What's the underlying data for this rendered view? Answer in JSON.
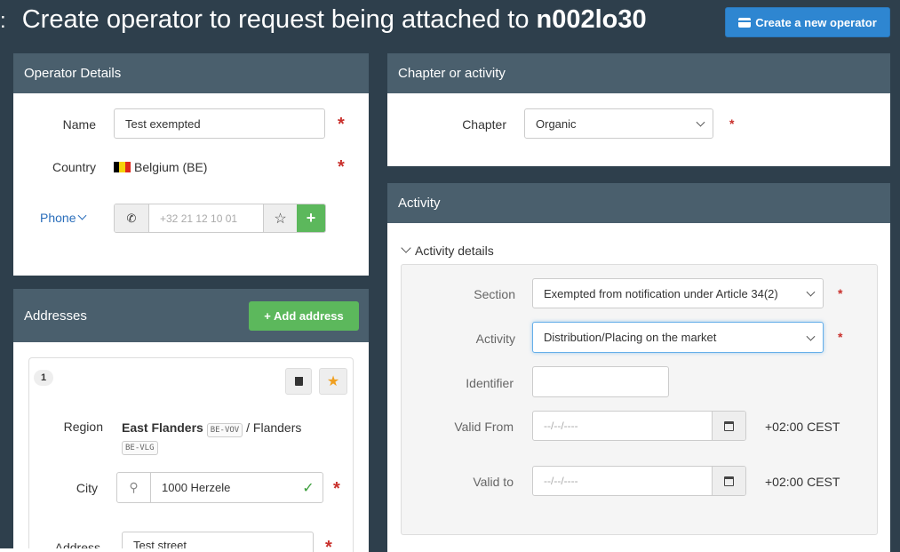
{
  "header": {
    "title_prefix": "Create operator to request being attached to ",
    "title_code": "n002lo30",
    "create_button": "Create a new operator"
  },
  "operator_details": {
    "heading": "Operator Details",
    "name_label": "Name",
    "name_value": "Test exempted",
    "country_label": "Country",
    "country_value": "Belgium (BE)",
    "phone_label": "Phone",
    "phone_placeholder": "+32 21 12 10 01"
  },
  "addresses": {
    "heading": "Addresses",
    "add_button": "+ Add address",
    "index": "1",
    "region_label": "Region",
    "region_name": "East Flanders",
    "region_code": "BE-VOV",
    "region_sep": " / Flanders",
    "region_parent_code": "BE-VLG",
    "city_label": "City",
    "city_value": "1000 Herzele",
    "address_label": "Address",
    "address_value": "Test street"
  },
  "chapter": {
    "heading": "Chapter or activity",
    "label": "Chapter",
    "value": "Organic"
  },
  "activity": {
    "heading": "Activity",
    "details_toggle": "Activity details",
    "section_label": "Section",
    "section_value": "Exempted from notification under Article 34(2)",
    "activity_label": "Activity",
    "activity_value": "Distribution/Placing on the market",
    "identifier_label": "Identifier",
    "identifier_value": "",
    "valid_from_label": "Valid From",
    "valid_from_placeholder": "--/--/----",
    "valid_to_label": "Valid to",
    "valid_to_placeholder": "--/--/----",
    "timezone": "+02:00 CEST"
  },
  "colors": {
    "background": "#2e3f4c",
    "panel_header": "#4a5f6d",
    "primary": "#2e86d1",
    "success": "#5cb85c",
    "required": "#c9302c",
    "focus": "#66afe9"
  }
}
